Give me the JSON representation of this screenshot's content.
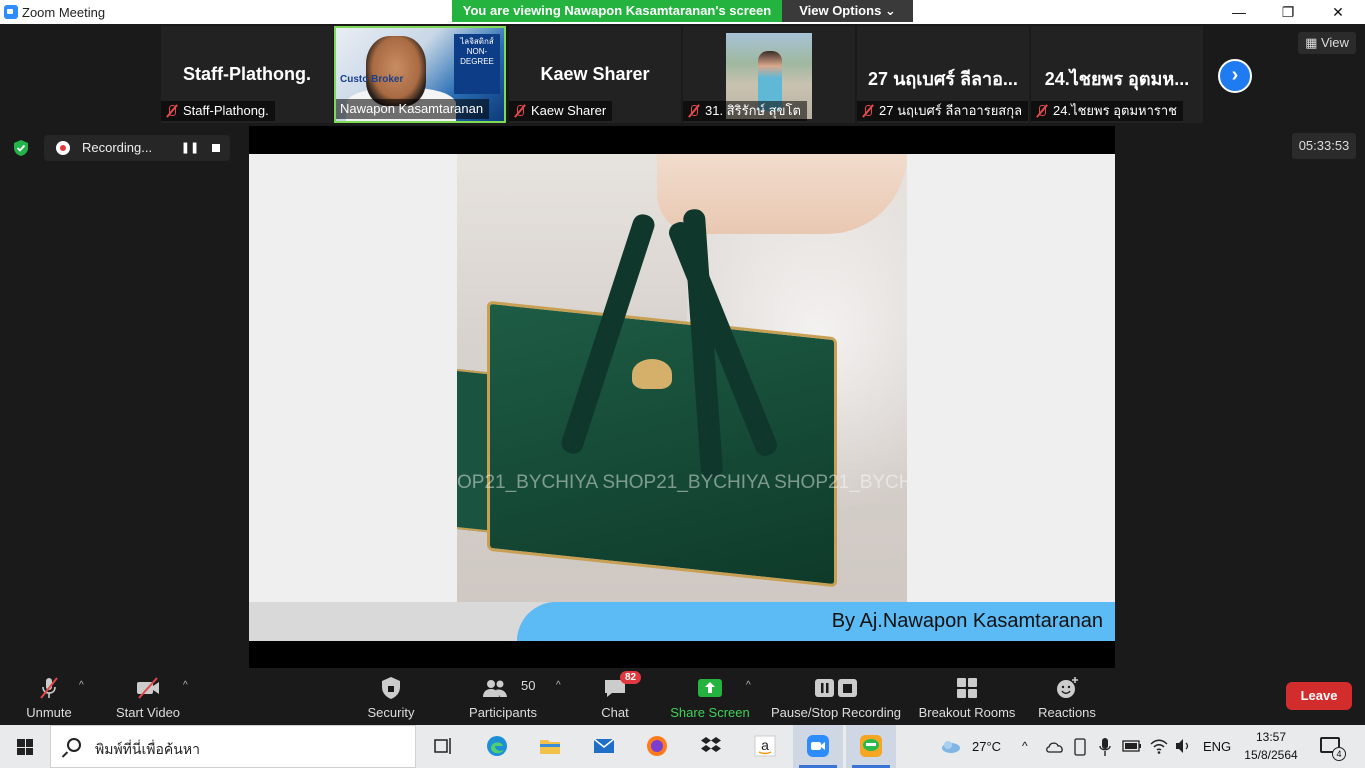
{
  "window": {
    "title": "Zoom Meeting",
    "viewing_banner": "You are viewing Nawapon Kasamtaranan's screen",
    "view_options": "View Options ⌄",
    "minimize": "—",
    "restore": "❐",
    "close": "✕"
  },
  "participants_strip": {
    "tiles": [
      {
        "big_name": "Staff-Plathong.",
        "label": "Staff-Plathong.",
        "muted": true
      },
      {
        "big_name": "",
        "label": "Nawapon Kasamtaranan",
        "muted": false,
        "active_speaker": true,
        "sign_text": "ไลจิสติกส์ NON-DEGREE",
        "sign_text2": "Custo Broker"
      },
      {
        "big_name": "Kaew Sharer",
        "label": "Kaew Sharer",
        "muted": true
      },
      {
        "big_name": "",
        "label": "31. สิริรักษ์ สุขโต",
        "muted": true
      },
      {
        "big_name": "27 นฤเบศร์ ลีลาอ...",
        "label": "27 นฤเบศร์ ลีลาอารยสกุล",
        "muted": true
      },
      {
        "big_name": "24.ไชยพร อุตมห...",
        "label": "24.ไชยพร อุตมหาราช",
        "muted": true
      }
    ],
    "next_arrow": "›",
    "view_button": "View"
  },
  "recording": {
    "label": "Recording...",
    "pause": "❚❚",
    "timer": "05:33:53"
  },
  "shared_slide": {
    "watermark": "OP21_BYCHIYA SHOP21_BYCHIYA SHOP21_BYCHIY",
    "byline": "By Aj.Nawapon Kasamtaranan"
  },
  "toolbar": {
    "unmute": "Unmute",
    "start_video": "Start Video",
    "security": "Security",
    "participants": "Participants",
    "participants_count": "50",
    "chat": "Chat",
    "chat_badge": "82",
    "share_screen": "Share Screen",
    "pause_stop_recording": "Pause/Stop Recording",
    "breakout_rooms": "Breakout Rooms",
    "reactions": "Reactions",
    "leave": "Leave",
    "caret": "^"
  },
  "taskbar": {
    "search_placeholder": "พิมพ์ที่นี่เพื่อค้นหา",
    "weather": "27°C",
    "language": "ENG",
    "time": "13:57",
    "date": "15/8/2564",
    "notification_count": "4",
    "chevron": "^"
  },
  "colors": {
    "banner_green": "#23b33e",
    "zoom_blue": "#2d8cff",
    "leave_red": "#d32c2c",
    "share_green": "#23b33e"
  }
}
